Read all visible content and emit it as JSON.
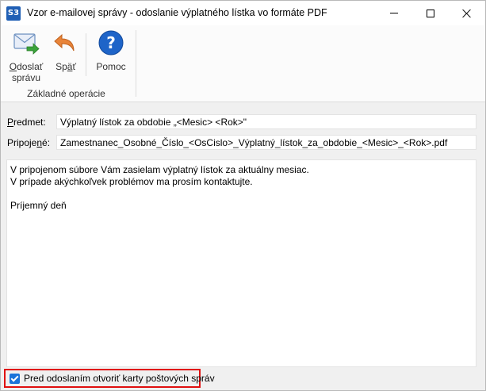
{
  "window": {
    "app_icon_text": "S3",
    "title": "Vzor e-mailovej správy - odoslanie výplatného lístka vo formáte PDF"
  },
  "ribbon": {
    "send": {
      "accel": "O",
      "rest1": "doslať",
      "line2": "správu",
      "icon": "mail-send-icon"
    },
    "back": {
      "pre": "Sp",
      "accel": "ä",
      "post": "ť",
      "icon": "undo-arrow-icon"
    },
    "help": {
      "label": "Pomoc",
      "icon": "help-icon"
    },
    "group_label": "Základné operácie"
  },
  "form": {
    "subject": {
      "accel": "P",
      "rest": "redmet:",
      "value": "Výplatný lístok za obdobie  „<Mesic> <Rok>\""
    },
    "attachment": {
      "pre": "Pripoje",
      "accel": "n",
      "post": "é:",
      "value": "Zamestnanec_Osobné_Číslo_<OsCislo>_Výplatný_lístok_za_obdobie_<Mesic>_<Rok>.pdf"
    },
    "body_lines": [
      "V pripojenom súbore Vám zasielam výplatný lístok za aktuálny mesiac.",
      "V prípade akýchkoľvek problémov ma prosím kontaktujte.",
      "",
      "Príjemný deň"
    ]
  },
  "footer": {
    "checkbox_label": "Pred odoslaním otvoriť karty poštových správ",
    "checkbox_checked": true
  },
  "colors": {
    "accent": "#1a73d9",
    "highlight_border": "#e01010"
  }
}
